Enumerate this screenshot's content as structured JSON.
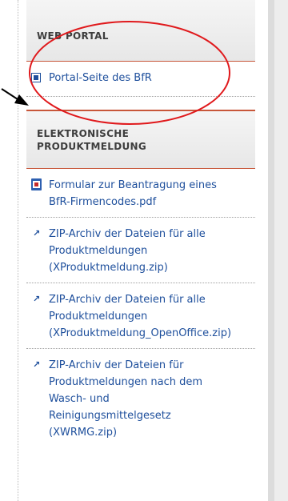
{
  "sections": {
    "web_portal": {
      "title": "WEB PORTAL",
      "link": "Portal-Seite des BfR"
    },
    "elektronisch": {
      "title_line1": "ELEKTRONISCHE",
      "title_line2": "PRODUKTMELDUNG",
      "items": [
        {
          "icon": "pdf-icon",
          "lines": [
            "Formular zur Beantragung eines",
            "BfR-Firmencodes.pdf"
          ]
        },
        {
          "icon": "arrow-icon",
          "lines": [
            "ZIP-Archiv der Dateien für alle",
            "Produktmeldungen",
            "(XProduktmeldung.zip)"
          ]
        },
        {
          "icon": "arrow-icon",
          "lines": [
            "ZIP-Archiv der Dateien für alle",
            "Produktmeldungen",
            "(XProduktmeldung_OpenOffice.zip)"
          ]
        },
        {
          "icon": "arrow-icon",
          "lines": [
            "ZIP-Archiv der Dateien für",
            "Produktmeldungen nach dem",
            "Wasch- und",
            "Reinigungsmittelgesetz",
            "(XWRMG.zip)"
          ]
        }
      ]
    }
  },
  "colors": {
    "link": "#1e4f9c",
    "accent_border": "#c8573a",
    "annotation": "#e0191c"
  }
}
